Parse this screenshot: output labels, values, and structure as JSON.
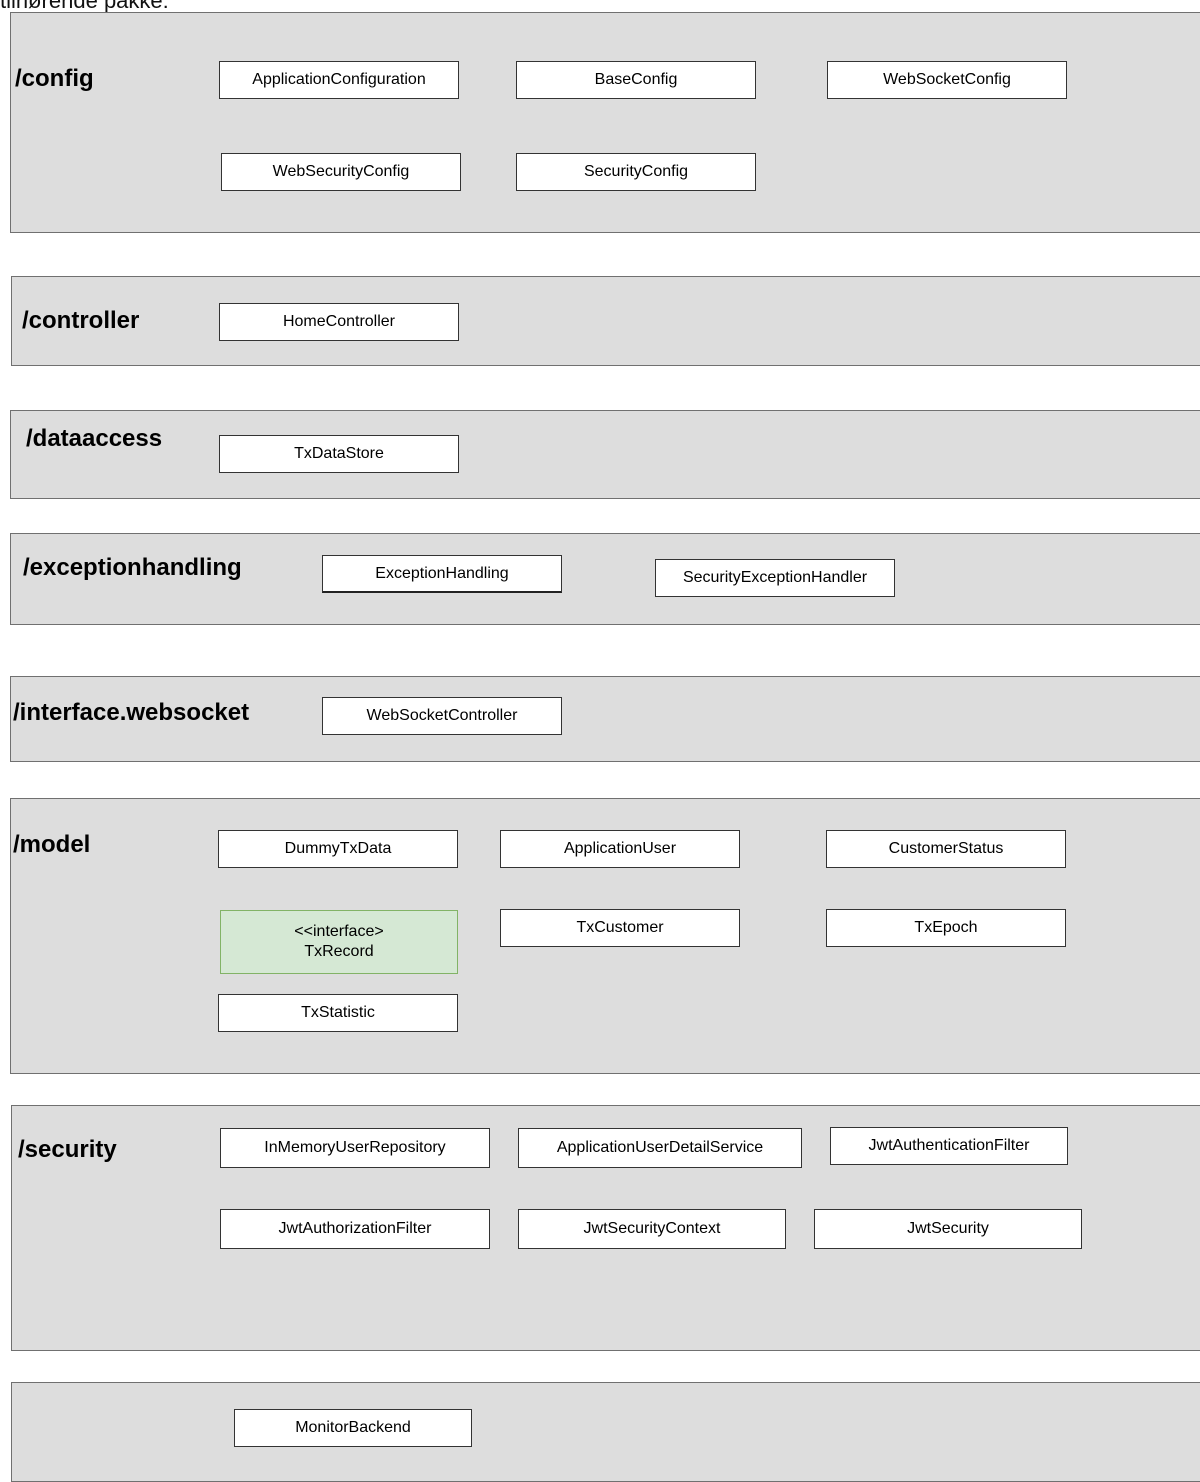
{
  "top_text": "tilhørende pakke:",
  "packages": {
    "config": {
      "label": "/config",
      "classes": [
        "ApplicationConfiguration",
        "BaseConfig",
        "WebSocketConfig",
        "WebSecurityConfig",
        "SecurityConfig"
      ]
    },
    "controller": {
      "label": "/controller",
      "classes": [
        "HomeController"
      ]
    },
    "dataaccess": {
      "label": "/dataaccess",
      "classes": [
        "TxDataStore"
      ]
    },
    "exceptionhandling": {
      "label": "/exceptionhandling",
      "classes": [
        "ExceptionHandling",
        "SecurityExceptionHandler"
      ]
    },
    "websocket": {
      "label": "/interface.websocket",
      "classes": [
        "WebSocketController"
      ]
    },
    "model": {
      "label": "/model",
      "classes": [
        "DummyTxData",
        "ApplicationUser",
        "CustomerStatus",
        "TxCustomer",
        "TxEpoch",
        "TxStatistic"
      ],
      "interface": {
        "stereotype": "<<interface>",
        "name": "TxRecord"
      }
    },
    "security": {
      "label": "/security",
      "classes": [
        "InMemoryUserRepository",
        "ApplicationUserDetailService",
        "JwtAuthenticationFilter",
        "JwtAuthorizationFilter",
        "JwtSecurityContext",
        "JwtSecurity"
      ]
    },
    "root": {
      "classes": [
        "MonitorBackend"
      ]
    }
  },
  "colors": {
    "package_fill": "#dddddd",
    "package_border": "#707070",
    "class_fill": "#ffffff",
    "interface_fill": "#d5e8d4",
    "interface_border": "#82b366"
  }
}
